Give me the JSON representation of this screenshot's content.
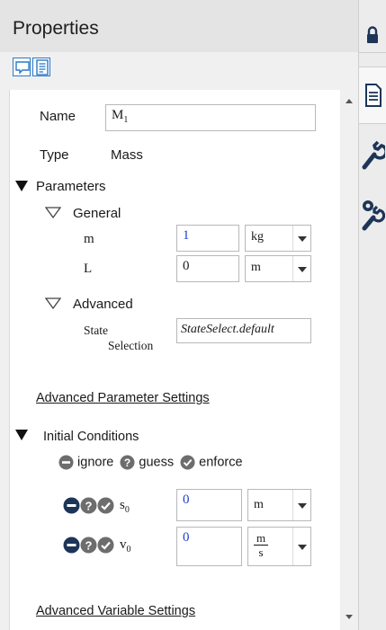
{
  "panel": {
    "title": "Properties",
    "view_buttons": [
      {
        "icon": "comment-view-icon"
      },
      {
        "icon": "document-view-icon"
      }
    ]
  },
  "rail": {
    "icons": [
      "lock-icon",
      "document-icon",
      "wrench-icon",
      "wrench-gear-icon"
    ]
  },
  "component": {
    "name_label": "Name",
    "name_value": "M",
    "name_subscript": "1",
    "type_label": "Type",
    "type_value": "Mass"
  },
  "parameters": {
    "header": "Parameters",
    "general": {
      "header": "General",
      "rows": [
        {
          "name": "m",
          "value": "1",
          "unit": "kg"
        },
        {
          "name": "L",
          "value": "0",
          "unit": "m"
        }
      ]
    },
    "advanced": {
      "header": "Advanced",
      "state_label_line1": "State",
      "state_label_line2": "Selection",
      "state_value": "StateSelect.default"
    },
    "advanced_link": "Advanced Parameter Settings"
  },
  "initial_conditions": {
    "header": "Initial Conditions",
    "options": [
      {
        "icon": "ignore-icon",
        "label": "ignore"
      },
      {
        "icon": "guess-icon",
        "label": "guess"
      },
      {
        "icon": "enforce-icon",
        "label": "enforce"
      }
    ],
    "rows": [
      {
        "name": "s",
        "subscript": "0",
        "value": "0",
        "unit": "m"
      },
      {
        "name": "v",
        "subscript": "0",
        "value": "0",
        "unit_num": "m",
        "unit_den": "s"
      }
    ],
    "advanced_link": "Advanced Variable Settings"
  },
  "colors": {
    "accent": "#2a79c8",
    "value_blue": "#1f3fd0",
    "icon_dark": "#1d3557",
    "icon_gray": "#6d6d6d"
  }
}
